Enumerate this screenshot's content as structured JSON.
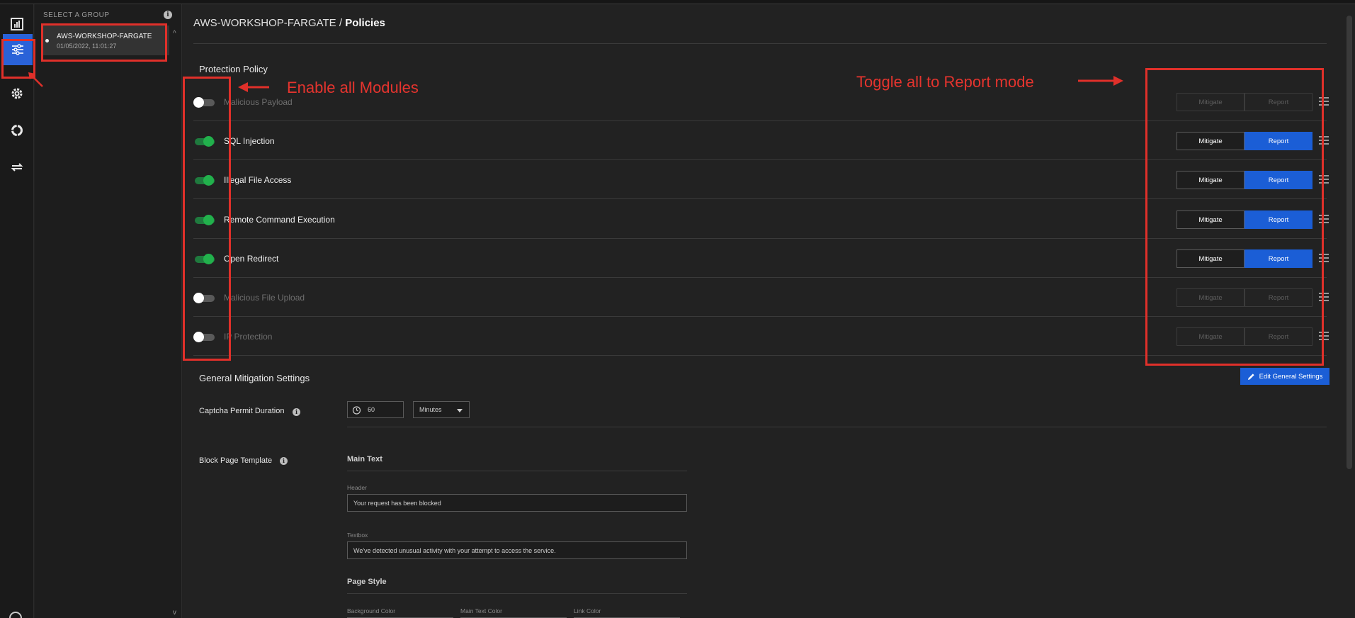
{
  "sidebar": {
    "icons": [
      "dashboard-icon",
      "policies-icon",
      "settings-icon",
      "integrations-icon",
      "sync-icon",
      "help-icon"
    ]
  },
  "groups": {
    "title": "SELECT A GROUP",
    "items": [
      {
        "name": "AWS-WORKSHOP-FARGATE",
        "date": "01/05/2022, 11:01:27"
      }
    ]
  },
  "breadcrumb": {
    "group": "AWS-WORKSHOP-FARGATE",
    "separator": " / ",
    "page": "Policies"
  },
  "protection_policy": {
    "title": "Protection Policy",
    "mitigate_label": "Mitigate",
    "report_label": "Report",
    "rows": [
      {
        "label": "Malicious Payload",
        "enabled": false,
        "mode": "none"
      },
      {
        "label": "SQL Injection",
        "enabled": true,
        "mode": "Report"
      },
      {
        "label": "Illegal File Access",
        "enabled": true,
        "mode": "Report"
      },
      {
        "label": "Remote Command Execution",
        "enabled": true,
        "mode": "Report"
      },
      {
        "label": "Open Redirect",
        "enabled": true,
        "mode": "Report"
      },
      {
        "label": "Malicious File Upload",
        "enabled": false,
        "mode": "none"
      },
      {
        "label": "IP Protection",
        "enabled": false,
        "mode": "none"
      }
    ]
  },
  "general": {
    "title": "General Mitigation Settings",
    "edit_button": "Edit General Settings",
    "captcha_label": "Captcha Permit Duration",
    "captcha_value": "60",
    "captcha_unit": "Minutes",
    "block_page_label": "Block Page Template",
    "main_text_title": "Main Text",
    "header_label": "Header",
    "header_value": "Your request has been blocked",
    "textbox_label": "Textbox",
    "textbox_value": "We've detected unusual activity with your attempt to access the service.",
    "page_style_title": "Page Style",
    "bg_color_label": "Background Color",
    "main_text_color_label": "Main Text Color",
    "link_color_label": "Link Color"
  },
  "annotations": {
    "enable_all": "Enable all Modules",
    "toggle_report": "Toggle all to Report mode",
    "color": "#e0302a"
  },
  "colors": {
    "accent": "#1b5ed6",
    "toggle_on": "#22b14c"
  }
}
